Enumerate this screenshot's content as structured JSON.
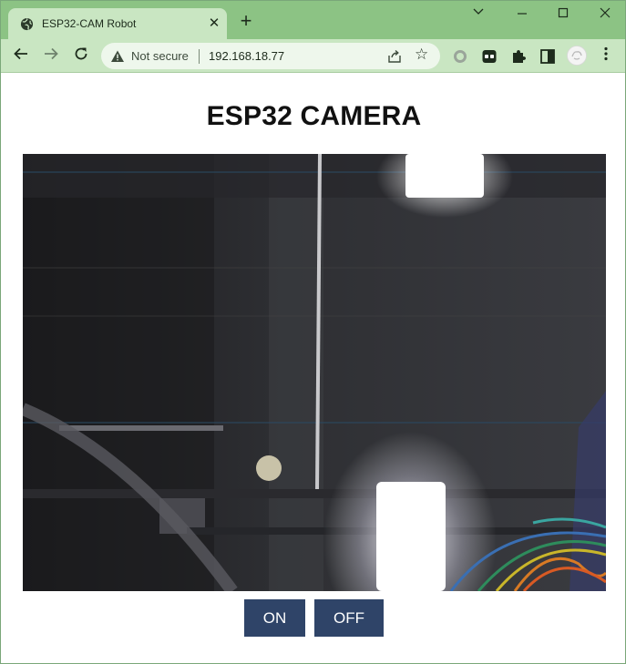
{
  "browser": {
    "tab_title": "ESP32-CAM Robot",
    "tab_close_glyph": "✕",
    "new_tab_glyph": "+",
    "security_label": "Not secure",
    "url": "192.168.18.77",
    "window_controls": {
      "minimize_glyph": "—",
      "maximize_glyph": "☐",
      "close_glyph": "✕",
      "chevron_glyph": "⌄"
    },
    "nav": {
      "back_glyph": "←",
      "forward_glyph": "→",
      "reload_glyph": "↻",
      "menu_glyph": "⋮"
    },
    "star_glyph": "☆",
    "icons": [
      "globe-icon",
      "warning-icon",
      "share-icon",
      "star-icon",
      "extension-circle-icon",
      "extension-mask-icon",
      "puzzle-icon",
      "sidepanel-icon",
      "profile-avatar-icon",
      "kebab-menu-icon"
    ],
    "colors": {
      "tab_strip": "#8cc384",
      "toolbar": "#c9e6c2",
      "omnibox": "#eef7ec"
    }
  },
  "page": {
    "title": "ESP32 CAMERA",
    "stream_alt": "camera stream",
    "buttons": {
      "on_label": "ON",
      "off_label": "OFF"
    },
    "colors": {
      "button_bg": "#2f4468",
      "button_text": "#ffffff"
    }
  }
}
